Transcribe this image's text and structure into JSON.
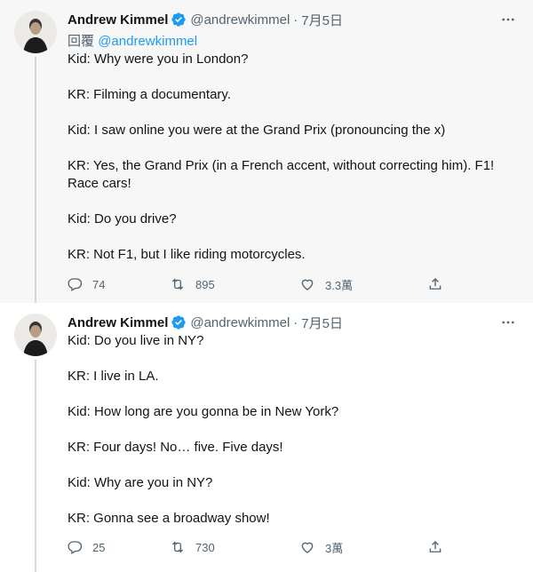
{
  "tweets": [
    {
      "name": "Andrew Kimmel",
      "handle": "@andrewkimmel",
      "dot": "·",
      "date": "7月5日",
      "reply_label": "回覆",
      "reply_mention": "@andrewkimmel",
      "paragraphs": [
        "Kid: Why were you in London?",
        "KR: Filming a documentary.",
        "Kid: I saw online you were at the Grand Prix (pronouncing the x)",
        "KR: Yes, the Grand Prix (in a French accent, without correcting him). F1!\nRace cars!",
        "Kid: Do you drive?",
        "KR: Not F1, but I like riding motorcycles."
      ],
      "replies": "74",
      "retweets": "895",
      "likes": "3.3萬"
    },
    {
      "name": "Andrew Kimmel",
      "handle": "@andrewkimmel",
      "dot": "·",
      "date": "7月5日",
      "paragraphs": [
        "Kid: Do you live in NY?",
        "KR: I live in LA.",
        "Kid: How long are you gonna be in New York?",
        "KR: Four days! No… five. Five days!",
        "Kid: Why are you in NY?",
        "KR: Gonna see a broadway show!"
      ],
      "replies": "25",
      "retweets": "730",
      "likes": "3萬"
    }
  ],
  "colors": {
    "accent": "#1d9bf0",
    "muted": "#536471",
    "text": "#0f1419"
  },
  "icons": [
    "verified-badge-icon",
    "more-icon",
    "reply-icon",
    "retweet-icon",
    "like-icon",
    "share-icon"
  ]
}
